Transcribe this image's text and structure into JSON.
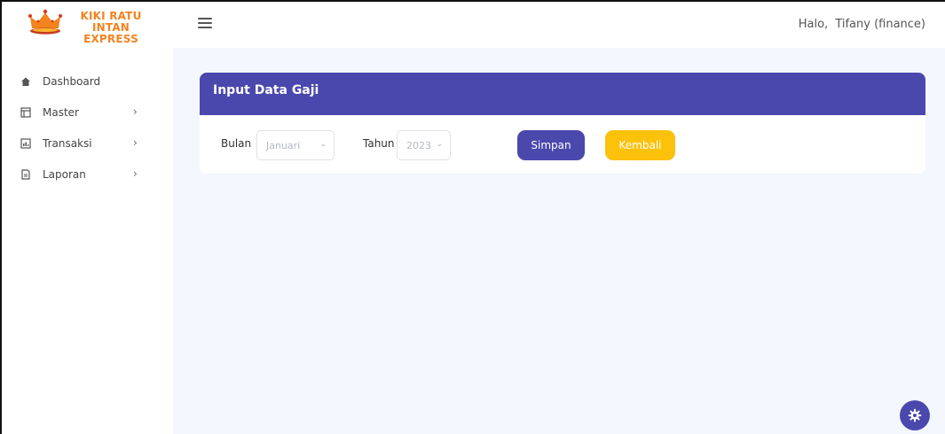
{
  "brand": {
    "line1": "KIKI RATU INTAN",
    "line2": "EXPRESS"
  },
  "header": {
    "greeting": "Halo,",
    "user": "Tifany (finance)"
  },
  "sidebar": {
    "items": [
      {
        "label": "Dashboard",
        "icon": "home-icon"
      },
      {
        "label": "Master",
        "icon": "table-icon"
      },
      {
        "label": "Transaksi",
        "icon": "chart-icon"
      },
      {
        "label": "Laporan",
        "icon": "document-icon"
      }
    ]
  },
  "form": {
    "title": "Input Data Gaji",
    "bulan_label": "Bulan",
    "bulan_value": "Januari",
    "tahun_label": "Tahun",
    "tahun_value": "2023",
    "save_label": "Simpan",
    "back_label": "Kembali"
  },
  "colors": {
    "primary": "#4a48ad",
    "warning": "#fcc10a",
    "brand": "#f2831e",
    "background": "#f4f7fd"
  }
}
